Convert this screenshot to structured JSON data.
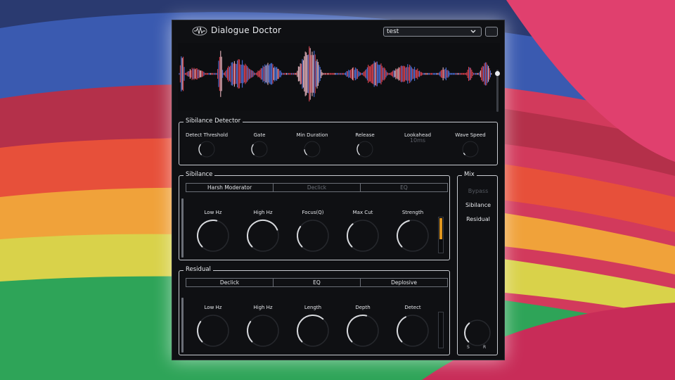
{
  "colors": {
    "accent": "#e0961e",
    "waveform_red": "#d8414f",
    "waveform_blue": "#4a6fd6",
    "waveform_pink": "#e8b4be",
    "panel_border": "#c9ccd2",
    "background": "#0f1013"
  },
  "header": {
    "title": "Dialogue Doctor",
    "logo_icon": "waveform-logo-icon",
    "preset_value": "test",
    "preset_icon": "chevron-down-icon"
  },
  "sibilance_detector": {
    "title": "Sibilance Detector",
    "knobs": [
      {
        "label": "Detect Threshold",
        "level": 0.3
      },
      {
        "label": "Gate",
        "level": 0.3
      },
      {
        "label": "Min Duration",
        "level": 0.15
      },
      {
        "label": "Release",
        "level": 0.3
      },
      {
        "label": "Lookahead",
        "readout": "10ms"
      },
      {
        "label": "Wave Speed",
        "level": 0.05
      }
    ]
  },
  "sibilance": {
    "title": "Sibilance",
    "tabs": [
      "Harsh Moderator",
      "Declick",
      "EQ"
    ],
    "active_tab": "Harsh Moderator",
    "knobs": [
      {
        "label": "Low Hz",
        "level": 0.55
      },
      {
        "label": "High Hz",
        "level": 0.75
      },
      {
        "label": "Focus(Q)",
        "level": 0.3
      },
      {
        "label": "Max Cut",
        "level": 0.35
      },
      {
        "label": "Strength",
        "level": 0.45
      }
    ],
    "meter_level": 0.6
  },
  "residual": {
    "title": "Residual",
    "tabs": [
      "Declick",
      "EQ",
      "Deplosive"
    ],
    "active_tab": "Deplosive",
    "knobs": [
      {
        "label": "Low Hz",
        "level": 0.3
      },
      {
        "label": "High Hz",
        "level": 0.3
      },
      {
        "label": "Length",
        "level": 0.65
      },
      {
        "label": "Depth",
        "level": 0.55
      },
      {
        "label": "Detect",
        "level": 0.4
      }
    ]
  },
  "mix": {
    "title": "Mix",
    "options": [
      "Bypass",
      "Sibilance",
      "Residual"
    ],
    "knob_level": 0.35,
    "s_label": "S",
    "r_label": "R"
  }
}
